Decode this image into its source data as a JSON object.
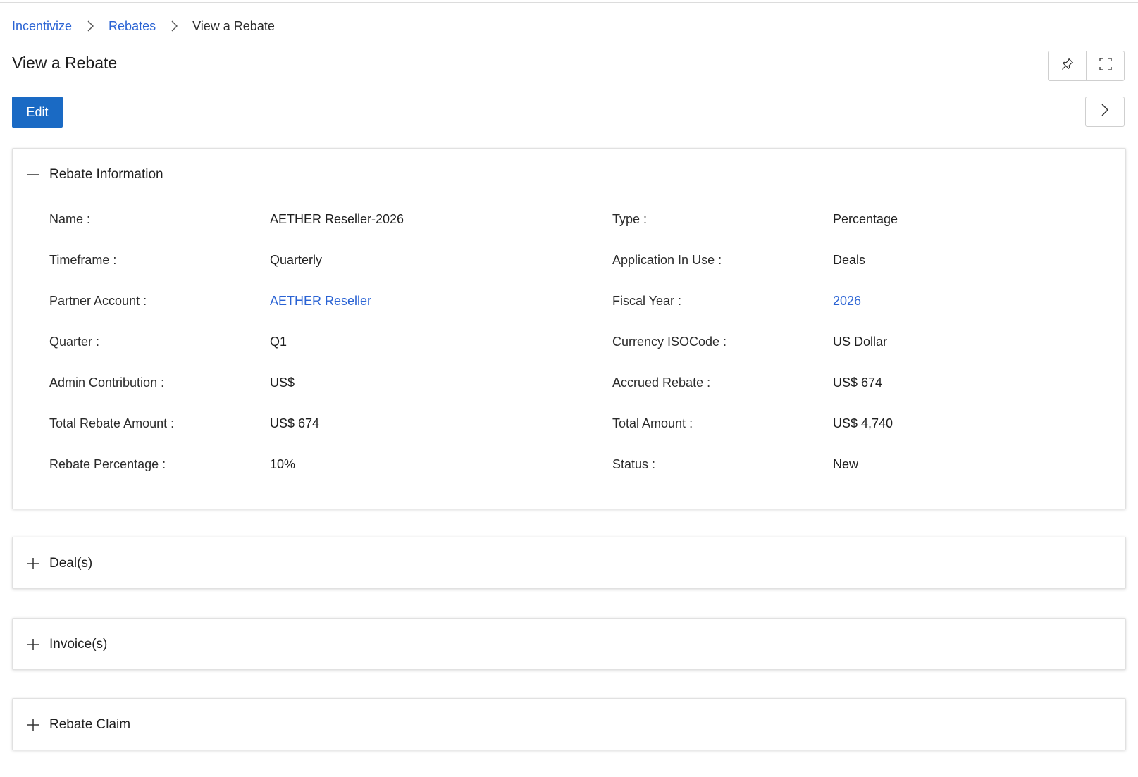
{
  "breadcrumb": {
    "items": [
      {
        "label": "Incentivize"
      },
      {
        "label": "Rebates"
      },
      {
        "label": "View a Rebate"
      }
    ]
  },
  "page": {
    "title": "View a Rebate"
  },
  "toolbar": {
    "edit_label": "Edit",
    "pin_icon": "pin-icon",
    "fullscreen_icon": "fullscreen-icon",
    "next_icon": "chevron-right-icon"
  },
  "rebate_info": {
    "title": "Rebate Information",
    "expanded": true,
    "fields": {
      "name": {
        "label": "Name :",
        "value": "AETHER Reseller-2026"
      },
      "type": {
        "label": "Type :",
        "value": "Percentage"
      },
      "timeframe": {
        "label": "Timeframe :",
        "value": "Quarterly"
      },
      "application": {
        "label": "Application In Use :",
        "value": "Deals"
      },
      "partner_account": {
        "label": "Partner Account :",
        "value": "AETHER Reseller"
      },
      "fiscal_year": {
        "label": "Fiscal Year :",
        "value": "2026"
      },
      "quarter": {
        "label": "Quarter :",
        "value": "Q1"
      },
      "currency": {
        "label": "Currency ISOCode :",
        "value": "US Dollar"
      },
      "admin_contribution": {
        "label": "Admin Contribution :",
        "value": "US$"
      },
      "accrued_rebate": {
        "label": "Accrued Rebate :",
        "value": "US$ 674"
      },
      "total_rebate_amount": {
        "label": "Total Rebate Amount :",
        "value": "US$ 674"
      },
      "total_amount": {
        "label": "Total Amount :",
        "value": "US$ 4,740"
      },
      "rebate_percentage": {
        "label": "Rebate Percentage :",
        "value": "10%"
      },
      "status": {
        "label": "Status :",
        "value": "New"
      }
    }
  },
  "sections": {
    "deals": {
      "title": "Deal(s)",
      "expanded": false
    },
    "invoices": {
      "title": "Invoice(s)",
      "expanded": false
    },
    "rebate_claim": {
      "title": "Rebate Claim",
      "expanded": false
    }
  },
  "colors": {
    "link": "#2a63d4",
    "primary_button": "#1a6ac4"
  }
}
